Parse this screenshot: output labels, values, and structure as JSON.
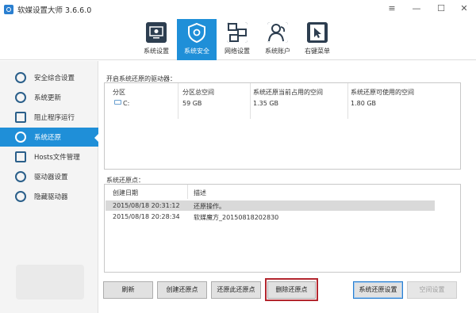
{
  "window": {
    "title": "软媒设置大师 3.6.6.0",
    "controls": {
      "menu": "≡",
      "minimize": "—",
      "maximize": "☐",
      "close": "✕"
    }
  },
  "toolbar": {
    "tabs": [
      {
        "label": "系统设置",
        "icon": "monitor-settings-icon",
        "active": false
      },
      {
        "label": "系统安全",
        "icon": "shield-icon",
        "active": true
      },
      {
        "label": "网络设置",
        "icon": "network-icon",
        "active": false
      },
      {
        "label": "系统账户",
        "icon": "users-icon",
        "active": false
      },
      {
        "label": "右键菜单",
        "icon": "cursor-icon",
        "active": false
      }
    ]
  },
  "sidebar": {
    "items": [
      {
        "label": "安全综合设置",
        "icon": "shield-icon",
        "active": false
      },
      {
        "label": "系统更新",
        "icon": "refresh-icon",
        "active": false
      },
      {
        "label": "阻止程序运行",
        "icon": "block-icon",
        "active": false
      },
      {
        "label": "系统还原",
        "icon": "restore-icon",
        "active": true
      },
      {
        "label": "Hosts文件管理",
        "icon": "hosts-icon",
        "active": false
      },
      {
        "label": "驱动器设置",
        "icon": "drive-icon",
        "active": false
      },
      {
        "label": "隐藏驱动器",
        "icon": "hidden-drive-icon",
        "active": false
      }
    ]
  },
  "drives_section": {
    "label": "开启系统还原的驱动器：",
    "columns": [
      "分区",
      "分区总空间",
      "系统还原当前占用的空间",
      "系统还原可使用的空间"
    ],
    "rows": [
      {
        "partition": "C:",
        "total": "59 GB",
        "used": "1.35 GB",
        "available": "1.80 GB"
      }
    ]
  },
  "restore_points": {
    "label": "系统还原点：",
    "columns": [
      "创建日期",
      "描述"
    ],
    "rows": [
      {
        "date": "2015/08/18 20:31:12",
        "description": "还原操作。",
        "selected": true
      },
      {
        "date": "2015/08/18 20:28:34",
        "description": "软媒魔方_20150818202830",
        "selected": false
      }
    ]
  },
  "buttons": {
    "refresh": "刷新",
    "create": "创建还原点",
    "restore": "还原此还原点",
    "delete": "删除还原点",
    "settings": "系统还原设置",
    "space": "空间设置"
  },
  "colors": {
    "accent": "#1f8fd8",
    "highlight": "#b3262e"
  }
}
